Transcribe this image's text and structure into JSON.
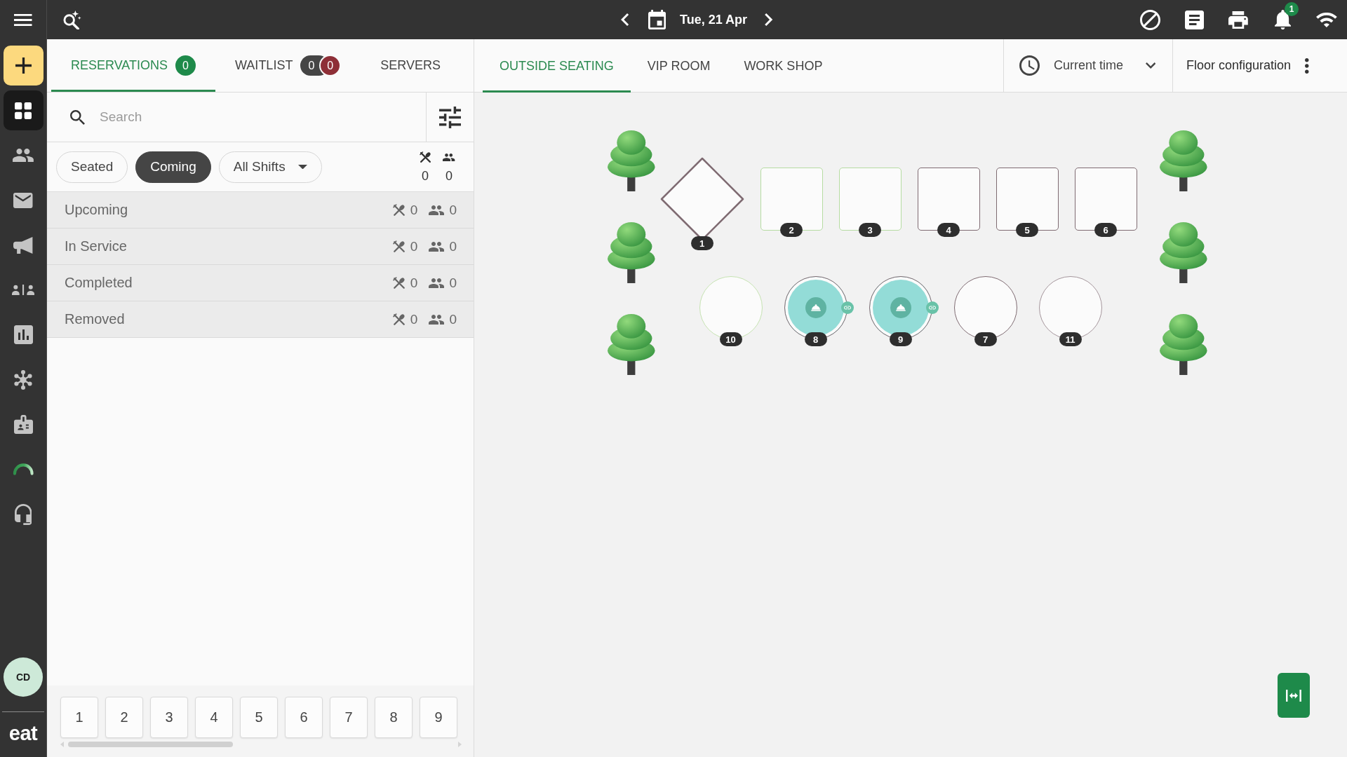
{
  "sidebar": {
    "items": [
      {
        "kind": "action",
        "selected": false
      },
      {
        "kind": "nav",
        "selected": true
      },
      {
        "kind": "nav",
        "selected": false
      },
      {
        "kind": "nav",
        "selected": false
      },
      {
        "kind": "nav",
        "selected": false
      },
      {
        "kind": "nav",
        "selected": false
      },
      {
        "kind": "nav",
        "selected": false
      },
      {
        "kind": "nav",
        "selected": false
      },
      {
        "kind": "nav",
        "selected": false
      },
      {
        "kind": "nav",
        "selected": false
      },
      {
        "kind": "nav",
        "selected": false
      }
    ],
    "avatar": "CD",
    "logo": "eat"
  },
  "top_bar": {
    "date": "Tue, 21 Apr",
    "notification_count": "1"
  },
  "list_tabs": [
    {
      "label": "RESERVATIONS",
      "selected": true,
      "badges": [
        {
          "count": "0",
          "color": "#1e8a4a"
        }
      ]
    },
    {
      "label": "WAITLIST",
      "selected": false,
      "badges": [
        {
          "count": "0",
          "color": "#454545"
        },
        {
          "count": "0",
          "color": "#8e2f37"
        }
      ]
    },
    {
      "label": "SERVERS",
      "selected": false
    }
  ],
  "search": {
    "placeholder": "Search"
  },
  "filter_chips": [
    {
      "label": "Seated",
      "kind": "toggle",
      "selected": false
    },
    {
      "label": "Coming",
      "kind": "toggle",
      "selected": true
    },
    {
      "label": "All Shifts",
      "kind": "dropdown",
      "selected": false
    }
  ],
  "totals": {
    "reservations": "0",
    "covers": "0"
  },
  "groups": [
    {
      "label": "Upcoming",
      "reservations": "0",
      "covers": "0"
    },
    {
      "label": "In Service",
      "reservations": "0",
      "covers": "0"
    },
    {
      "label": "Completed",
      "reservations": "0",
      "covers": "0"
    },
    {
      "label": "Removed",
      "reservations": "0",
      "covers": "0"
    }
  ],
  "party_size_keys": [
    "1",
    "2",
    "3",
    "4",
    "5",
    "6",
    "7",
    "8",
    "9"
  ],
  "floor_tabs": [
    {
      "label": "OUTSIDE SEATING",
      "selected": true
    },
    {
      "label": "VIP ROOM",
      "selected": false
    },
    {
      "label": "WORK SHOP",
      "selected": false
    }
  ],
  "time_select": {
    "value": "Current time"
  },
  "floor_configuration": {
    "label": "Floor configuration"
  },
  "floor": {
    "left_decor": [
      {
        "kind": "tree"
      },
      {
        "kind": "tree"
      },
      {
        "kind": "tree"
      }
    ],
    "rows": [
      {
        "tables": [
          {
            "number": "1",
            "kind": "diamond",
            "color": "#7f6b72",
            "occupied": false,
            "linked": false
          },
          {
            "number": "2",
            "kind": "square",
            "color": "#b6dca2",
            "occupied": false,
            "linked": false
          },
          {
            "number": "3",
            "kind": "square",
            "color": "#b6dca2",
            "occupied": false,
            "linked": false
          },
          {
            "number": "4",
            "kind": "square",
            "color": "#7f6b72",
            "occupied": false,
            "linked": false
          },
          {
            "number": "5",
            "kind": "square",
            "color": "#7f6b72",
            "occupied": false,
            "linked": false
          },
          {
            "number": "6",
            "kind": "square",
            "color": "#7f6b72",
            "occupied": false,
            "linked": false
          }
        ]
      },
      {
        "tables": [
          {
            "number": "10",
            "kind": "round",
            "color": "#c6e3b2",
            "occupied": false,
            "linked": false
          },
          {
            "number": "8",
            "kind": "round",
            "color": "#7f6b72",
            "occupied": true,
            "linked": true
          },
          {
            "number": "9",
            "kind": "round",
            "color": "#7f6b72",
            "occupied": true,
            "linked": true
          },
          {
            "number": "7",
            "kind": "round",
            "color": "#7f6b72",
            "occupied": false,
            "linked": false
          },
          {
            "number": "11",
            "kind": "round",
            "color": "#a5969c",
            "occupied": false,
            "linked": false
          }
        ]
      }
    ],
    "right_decor": [
      {
        "kind": "tree"
      },
      {
        "kind": "tree"
      },
      {
        "kind": "tree"
      }
    ]
  }
}
